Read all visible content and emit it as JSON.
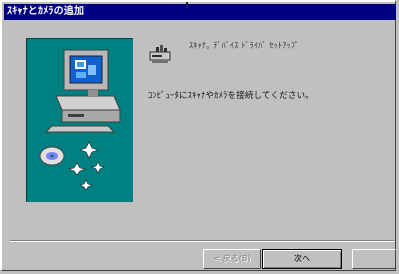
{
  "window": {
    "title": "ｽｷｬﾅとｶﾒﾗの追加"
  },
  "content": {
    "line1": "ｽｷｬﾅ｡ ﾃﾞﾊﾞｲｽ ﾄﾞﾗｲﾊﾞ ｾｯﾄｱｯﾌﾟ",
    "line2": "ｺﾝﾋﾟｭｰﾀにｽｷｬﾅやｶﾒﾗを接続してください。"
  },
  "buttons": {
    "back": "< 戻る(B)",
    "next": "次へ",
    "cancel": ""
  },
  "icons": {
    "drive": "scanner-drive-icon",
    "computer": "computer-illustration-icon",
    "disc": "disc-icon",
    "sparkles": "sparkle-icon"
  },
  "colors": {
    "titlebar": "#000080",
    "panel": "#008080",
    "face": "#c0c0c0"
  }
}
